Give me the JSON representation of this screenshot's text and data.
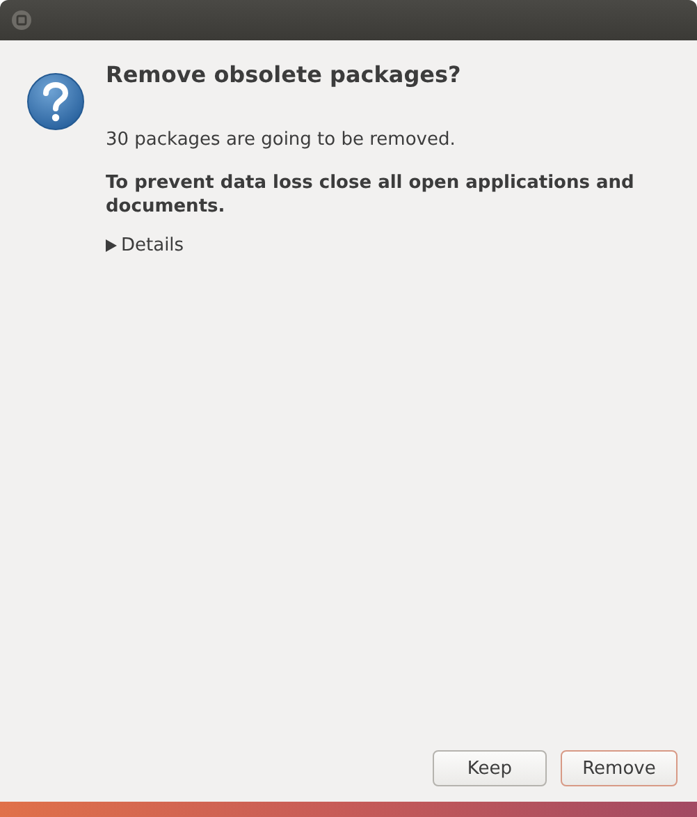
{
  "dialog": {
    "title": "Remove obsolete packages?",
    "message": "30 packages are going to be removed.",
    "warning": "To prevent data loss close all open applications and documents.",
    "details": {
      "label": "Details",
      "expanded": false
    }
  },
  "buttons": [
    {
      "label": "Keep",
      "default": false
    },
    {
      "label": "Remove",
      "default": true
    }
  ]
}
